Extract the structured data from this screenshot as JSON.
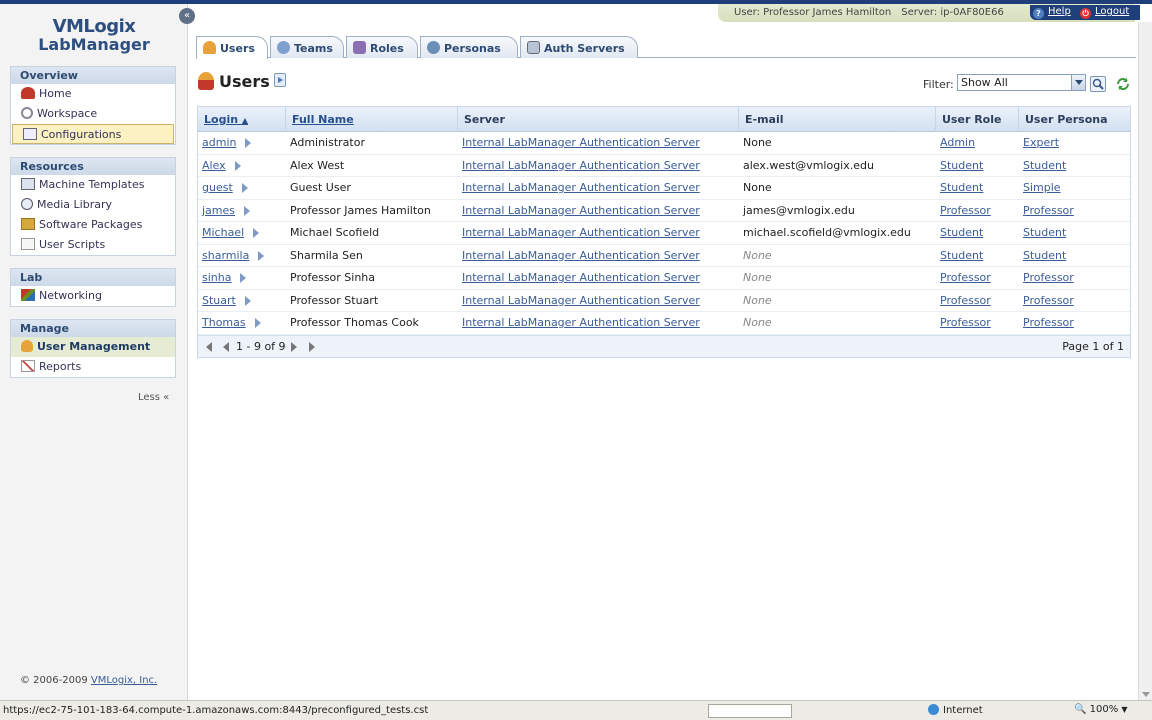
{
  "topbar": {
    "user_text": "User: Professor James Hamilton",
    "server_text": "Server: ip-0AF80E66",
    "help_label": "Help",
    "logout_label": "Logout"
  },
  "logo": {
    "line1": "VMLogix",
    "line2": "LabManager"
  },
  "sidebar": {
    "collapse_glyph": "«",
    "groups": [
      {
        "title": "Overview",
        "items": [
          {
            "label": "Home",
            "icon": "home-icon"
          },
          {
            "label": "Workspace",
            "icon": "workspace-icon"
          },
          {
            "label": "Configurations",
            "icon": "configurations-icon"
          }
        ]
      },
      {
        "title": "Resources",
        "items": [
          {
            "label": "Machine Templates",
            "icon": "machine-templates-icon"
          },
          {
            "label": "Media Library",
            "icon": "media-library-icon"
          },
          {
            "label": "Software Packages",
            "icon": "software-packages-icon"
          },
          {
            "label": "User Scripts",
            "icon": "user-scripts-icon"
          }
        ]
      },
      {
        "title": "Lab",
        "items": [
          {
            "label": "Networking",
            "icon": "networking-icon"
          }
        ]
      },
      {
        "title": "Manage",
        "items": [
          {
            "label": "User Management",
            "icon": "user-management-icon"
          },
          {
            "label": "Reports",
            "icon": "reports-icon"
          }
        ]
      }
    ],
    "less_label": "Less «",
    "copyright": "© 2006-2009",
    "copyright_link": "VMLogix, Inc."
  },
  "tabs": [
    {
      "label": "Users",
      "icon": "users-icon"
    },
    {
      "label": "Teams",
      "icon": "teams-icon"
    },
    {
      "label": "Roles",
      "icon": "roles-icon"
    },
    {
      "label": "Personas",
      "icon": "personas-icon"
    },
    {
      "label": "Auth Servers",
      "icon": "auth-servers-icon"
    }
  ],
  "page": {
    "title": "Users",
    "filter_label": "Filter:",
    "filter_value": "Show All"
  },
  "table": {
    "columns": [
      "Login",
      "Full Name",
      "Server",
      "E-mail",
      "User Role",
      "User Persona"
    ],
    "rows": [
      {
        "login": "admin",
        "full_name": "Administrator",
        "server": "Internal LabManager Authentication Server",
        "email": "None",
        "role": "Admin",
        "persona": "Expert"
      },
      {
        "login": "Alex",
        "full_name": "Alex West",
        "server": "Internal LabManager Authentication Server",
        "email": "alex.west@vmlogix.edu",
        "role": "Student",
        "persona": "Student"
      },
      {
        "login": "guest",
        "full_name": "Guest User",
        "server": "Internal LabManager Authentication Server",
        "email": "None",
        "role": "Student",
        "persona": "Simple"
      },
      {
        "login": "james",
        "full_name": "Professor James Hamilton",
        "server": "Internal LabManager Authentication Server",
        "email": "james@vmlogix.edu",
        "role": "Professor",
        "persona": "Professor"
      },
      {
        "login": "Michael",
        "full_name": "Michael Scofield",
        "server": "Internal LabManager Authentication Server",
        "email": "michael.scofield@vmlogix.edu",
        "role": "Student",
        "persona": "Student"
      },
      {
        "login": "sharmila",
        "full_name": "Sharmila Sen",
        "server": "Internal LabManager Authentication Server",
        "email": "None",
        "role": "Student",
        "persona": "Student"
      },
      {
        "login": "sinha",
        "full_name": "Professor Sinha",
        "server": "Internal LabManager Authentication Server",
        "email": "None",
        "role": "Professor",
        "persona": "Professor"
      },
      {
        "login": "Stuart",
        "full_name": "Professor Stuart",
        "server": "Internal LabManager Authentication Server",
        "email": "None",
        "role": "Professor",
        "persona": "Professor"
      },
      {
        "login": "Thomas",
        "full_name": "Professor Thomas Cook",
        "server": "Internal LabManager Authentication Server",
        "email": "None",
        "role": "Professor",
        "persona": "Professor"
      }
    ],
    "pager_range": "1 - 9 of 9",
    "pager_page": "Page 1 of 1"
  },
  "statusbar": {
    "url": "https://ec2-75-101-183-64.compute-1.amazonaws.com:8443/preconfigured_tests.cst",
    "zone": "Internet",
    "zoom": "100%"
  }
}
